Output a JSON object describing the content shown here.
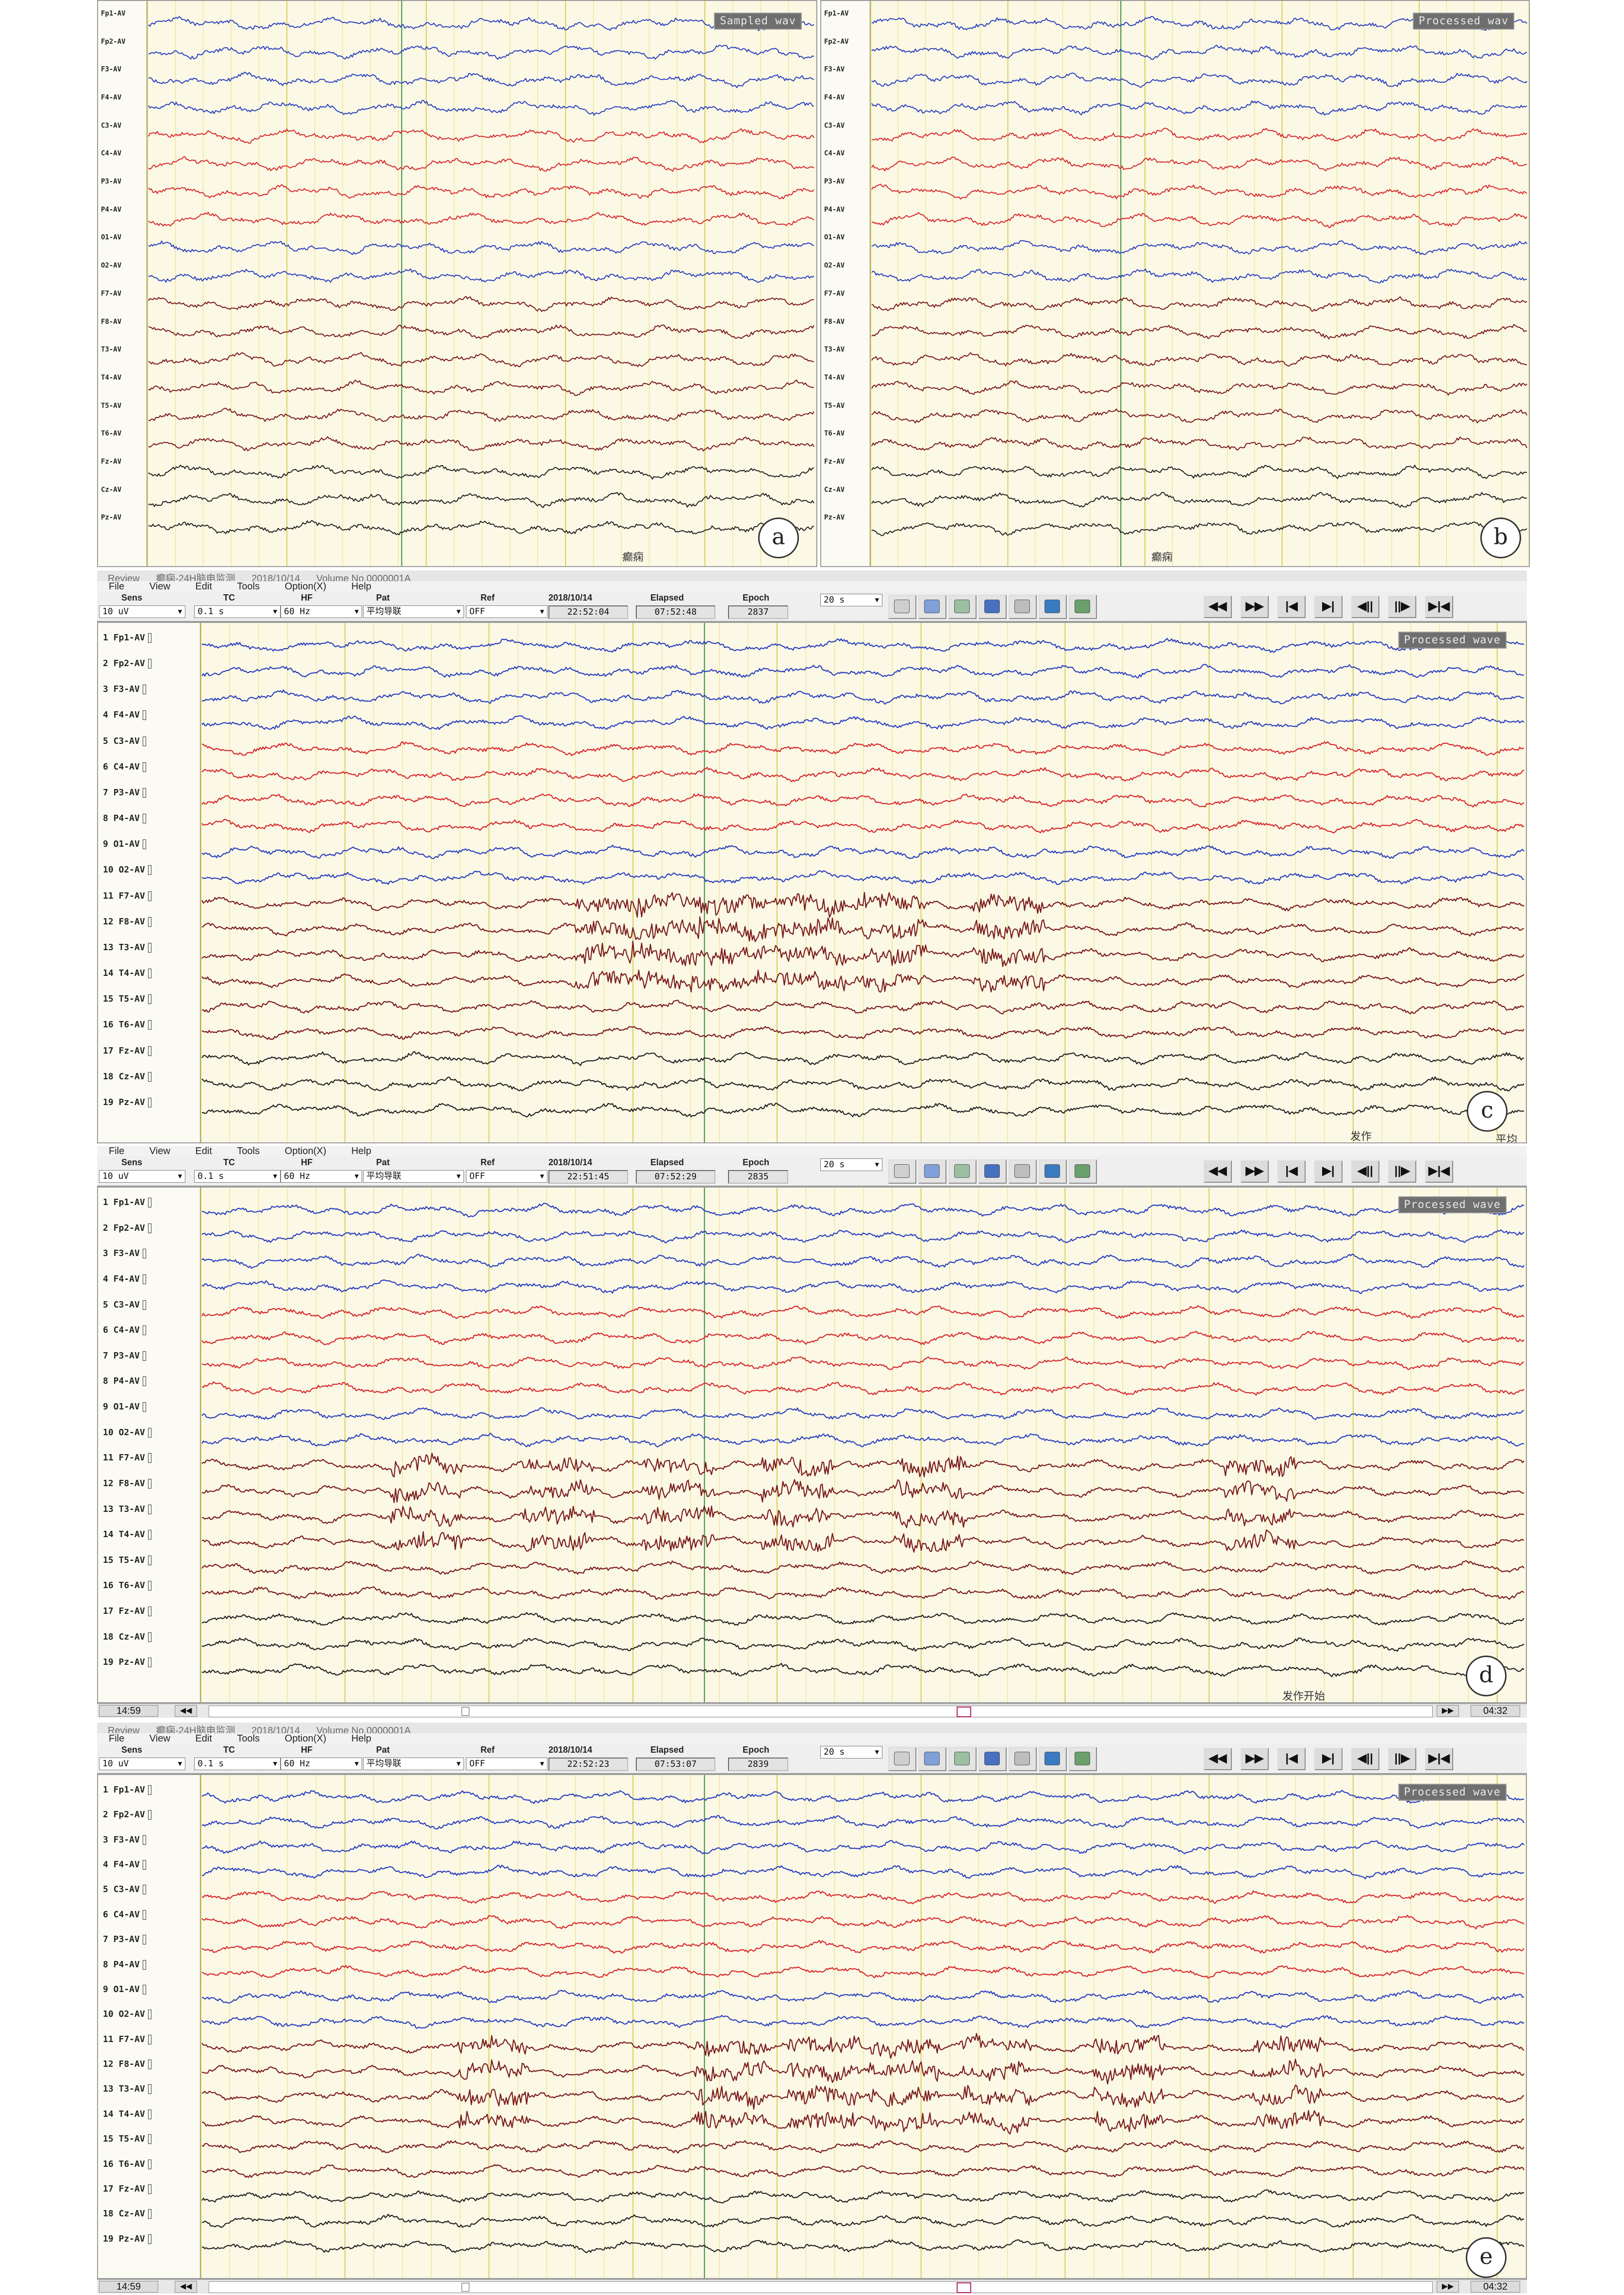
{
  "channels_ab": [
    "Fp1-AV",
    "Fp2-AV",
    "F3-AV",
    "F4-AV",
    "C3-AV",
    "C4-AV",
    "P3-AV",
    "P4-AV",
    "O1-AV",
    "O2-AV",
    "F7-AV",
    "F8-AV",
    "T3-AV",
    "T4-AV",
    "T5-AV",
    "T6-AV",
    "Fz-AV",
    "Cz-AV",
    "Pz-AV"
  ],
  "channels_cde": [
    "1 Fp1-AV",
    "2 Fp2-AV",
    "3 F3-AV",
    "4 F4-AV",
    "5 C3-AV",
    "6 C4-AV",
    "7 P3-AV",
    "8 P4-AV",
    "9 O1-AV",
    "10 O2-AV",
    "11 F7-AV",
    "12 F8-AV",
    "13 T3-AV",
    "14 T4-AV",
    "15 T5-AV",
    "16 T6-AV",
    "17 Fz-AV",
    "18 Cz-AV",
    "19 Pz-AV"
  ],
  "colors": {
    "blue": "#2a3fbf",
    "red": "#d8282c",
    "brown": "#7a1a1a",
    "black": "#222222",
    "grid_yellow": "#e8df70",
    "grid_green": "#3a8a3a"
  },
  "panel_a": {
    "label": "a",
    "badge": "Sampled wav",
    "marker": "癫痫"
  },
  "panel_b": {
    "label": "b",
    "badge": "Processed wav",
    "marker": "癫痫"
  },
  "panel_c": {
    "label": "c",
    "title": [
      "Review",
      "癫痫-24H脑电监测",
      "2018/10/14",
      "Volume No.0000001A"
    ],
    "menu": [
      "File",
      "View",
      "Edit",
      "Tools",
      "Option(X)",
      "Help"
    ],
    "headers": {
      "sens": "Sens",
      "tc": "TC",
      "hf": "HF",
      "pat": "Pat",
      "ref": "Ref",
      "date": "2018/10/14",
      "elapsed": "Elapsed",
      "epoch": "Epoch"
    },
    "values": {
      "sens": "10 uV",
      "tc": "0.1 s",
      "hf": "60 Hz",
      "pat": "平均导联",
      "ref": "OFF",
      "time": "22:52:04",
      "elapsed": "07:52:48",
      "epoch": "2837",
      "page": "20 s"
    },
    "badge": "Processed wave",
    "marker": "发作",
    "marker2": "平均"
  },
  "panel_d": {
    "label": "d",
    "menu": [
      "File",
      "View",
      "Edit",
      "Tools",
      "Option(X)",
      "Help"
    ],
    "headers": {
      "sens": "Sens",
      "tc": "TC",
      "hf": "HF",
      "pat": "Pat",
      "ref": "Ref",
      "date": "2018/10/14",
      "elapsed": "Elapsed",
      "epoch": "Epoch"
    },
    "values": {
      "sens": "10 uV",
      "tc": "0.1 s",
      "hf": "60 Hz",
      "pat": "平均导联",
      "ref": "OFF",
      "time": "22:51:45",
      "elapsed": "07:52:29",
      "epoch": "2835",
      "page": "20 s"
    },
    "badge": "Processed wave",
    "marker": "发作开始",
    "status": {
      "left_time": "14:59",
      "right_time": "04:32"
    }
  },
  "panel_e": {
    "label": "e",
    "title": [
      "Review",
      "癫痫-24H脑电监测",
      "2018/10/14",
      "Volume No.0000001A"
    ],
    "menu": [
      "File",
      "View",
      "Edit",
      "Tools",
      "Option(X)",
      "Help"
    ],
    "headers": {
      "sens": "Sens",
      "tc": "TC",
      "hf": "HF",
      "pat": "Pat",
      "ref": "Ref",
      "date": "2018/10/14",
      "elapsed": "Elapsed",
      "epoch": "Epoch"
    },
    "values": {
      "sens": "10 uV",
      "tc": "0.1 s",
      "hf": "60 Hz",
      "pat": "平均导联",
      "ref": "OFF",
      "time": "22:52:23",
      "elapsed": "07:53:07",
      "epoch": "2839",
      "page": "20 s"
    },
    "badge": "Processed wave",
    "status": {
      "left_time": "14:59",
      "right_time": "04:32"
    }
  },
  "nav_buttons": [
    "◀◀",
    "▶▶",
    "|◀",
    "▶|",
    "◀||",
    "||▶",
    "▶|◀"
  ]
}
